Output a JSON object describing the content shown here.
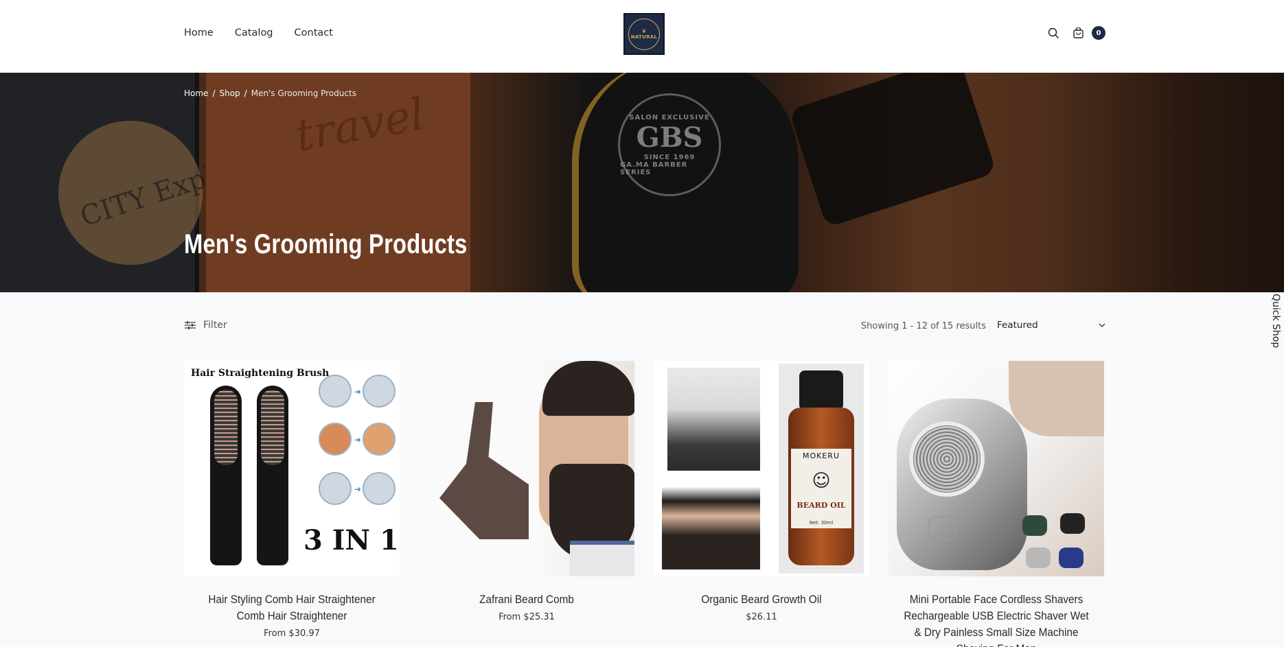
{
  "header": {
    "nav": [
      "Home",
      "Catalog",
      "Contact"
    ],
    "logo": {
      "brand": "NATURAL"
    },
    "cart_count": "0"
  },
  "hero": {
    "breadcrumb": [
      "Home",
      "Shop",
      "Men's Grooming Products"
    ],
    "title": "Men's Grooming Products",
    "image_text": {
      "tag": "CITY Exploration",
      "leather": "travel",
      "badge_top": "SALON EXCLUSIVE",
      "badge_main": "GBS",
      "badge_since": "SINCE 1969",
      "badge_bottom": "GA.MA BARBER SERIES"
    }
  },
  "toolbar": {
    "filter_label": "Filter",
    "results_text": "Showing 1 - 12 of 15 results",
    "sort_selected": "Featured"
  },
  "quick_shop": "Quick Shop",
  "products": [
    {
      "title": "Hair Styling Comb Hair Straightener Comb Hair Straightener",
      "price": "From $30.97",
      "image_text": {
        "heading": "Hair Straightening Brush",
        "badge": "3 IN 1"
      }
    },
    {
      "title": "Zafrani Beard Comb",
      "price": "From $25.31"
    },
    {
      "title": "Organic Beard Growth Oil",
      "price": "$26.11",
      "image_text": {
        "brand": "MOKERU",
        "name": "BEARD OIL",
        "net": "Net: 30ml"
      }
    },
    {
      "title": "Mini Portable Face Cordless Shavers Rechargeable USB Electric Shaver Wet & Dry Painless Small Size Machine Shaving For Men",
      "price": ""
    }
  ]
}
